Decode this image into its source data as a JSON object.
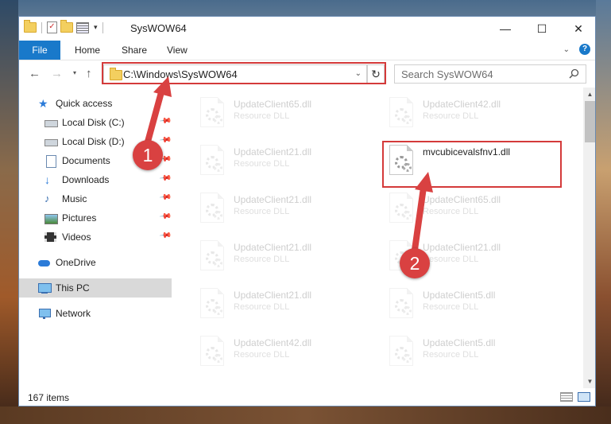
{
  "window": {
    "title": "SysWOW64"
  },
  "ribbon": {
    "file_tab": "File",
    "tabs": [
      "Home",
      "Share",
      "View"
    ],
    "help_label": "?"
  },
  "window_controls": {
    "minimize": "—",
    "maximize": "☐",
    "close": "✕"
  },
  "address": {
    "path": "C:\\Windows\\SysWOW64"
  },
  "search": {
    "placeholder": "Search SysWOW64"
  },
  "nav_pane": {
    "items": [
      {
        "label": "Quick access",
        "icon": "star-icon"
      },
      {
        "label": "Local Disk (C:)",
        "icon": "drive-icon"
      },
      {
        "label": "Local Disk (D:)",
        "icon": "drive-icon"
      },
      {
        "label": "Documents",
        "icon": "documents-icon"
      },
      {
        "label": "Downloads",
        "icon": "download-icon"
      },
      {
        "label": "Music",
        "icon": "music-icon"
      },
      {
        "label": "Pictures",
        "icon": "pictures-icon"
      },
      {
        "label": "Videos",
        "icon": "videos-icon"
      },
      {
        "label": "OneDrive",
        "icon": "cloud-icon"
      },
      {
        "label": "This PC",
        "icon": "computer-icon"
      },
      {
        "label": "Network",
        "icon": "network-icon"
      }
    ],
    "selected": "This PC"
  },
  "files": [
    {
      "name": "UpdateClient65.dll",
      "type": "Resource DLL"
    },
    {
      "name": "UpdateClient42.dll",
      "type": "Resource DLL"
    },
    {
      "name": "UpdateClient21.dll",
      "type": "Resource DLL"
    },
    {
      "name": "mvcubicevalsfnv1.dll",
      "type": ""
    },
    {
      "name": "UpdateClient21.dll",
      "type": "Resource DLL"
    },
    {
      "name": "UpdateClient65.dll",
      "type": "Resource DLL"
    },
    {
      "name": "UpdateClient21.dll",
      "type": "Resource DLL"
    },
    {
      "name": "UpdateClient21.dll",
      "type": "Resource DLL"
    },
    {
      "name": "UpdateClient21.dll",
      "type": "Resource DLL"
    },
    {
      "name": "UpdateClient5.dll",
      "type": "Resource DLL"
    },
    {
      "name": "UpdateClient42.dll",
      "type": "Resource DLL"
    },
    {
      "name": "UpdateClient5.dll",
      "type": "Resource DLL"
    }
  ],
  "status": {
    "item_count": "167 items"
  },
  "annotations": {
    "marker_1": "1",
    "marker_2": "2"
  },
  "colors": {
    "accent": "#1979ca",
    "highlight_red": "#d43a3a",
    "marker_red": "#d94141"
  }
}
